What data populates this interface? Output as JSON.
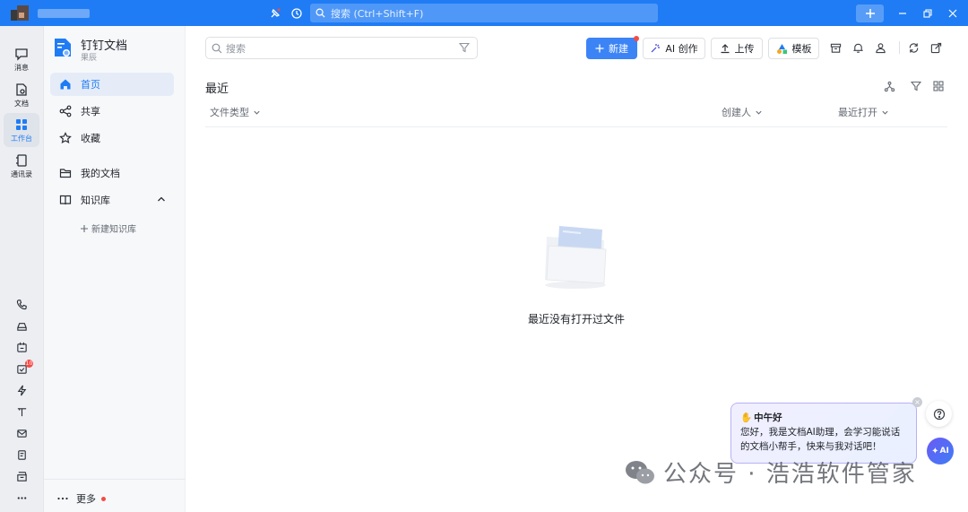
{
  "topbar": {
    "search_placeholder": "搜索 (Ctrl+Shift+F)"
  },
  "rail": {
    "items": [
      {
        "label": "消息",
        "icon": "message-icon"
      },
      {
        "label": "文档",
        "icon": "doc-icon"
      },
      {
        "label": "工作台",
        "icon": "workbench-icon"
      },
      {
        "label": "通讯录",
        "icon": "contacts-icon"
      }
    ],
    "badge_count": "10"
  },
  "sidebar": {
    "app_title": "钉钉文档",
    "app_subtitle": "果辰",
    "nav": [
      {
        "label": "首页",
        "icon": "home-icon"
      },
      {
        "label": "共享",
        "icon": "share-icon"
      },
      {
        "label": "收藏",
        "icon": "star-icon"
      },
      {
        "label": "我的文档",
        "icon": "folder-icon"
      },
      {
        "label": "知识库",
        "icon": "book-icon"
      }
    ],
    "new_kb": "新建知识库",
    "more": "更多"
  },
  "main": {
    "search_placeholder": "搜索",
    "buttons": {
      "new": "新建",
      "ai_create": "AI 创作",
      "upload": "上传",
      "template": "模板"
    },
    "section_title": "最近",
    "columns": {
      "file_type": "文件类型",
      "creator": "创建人",
      "last_opened": "最近打开"
    },
    "empty_text": "最近没有打开过文件"
  },
  "ai_assistant": {
    "greeting": "中午好",
    "message": "您好，我是文档AI助理，会学习能说话的文档小帮手，快来与我对话吧！",
    "button_label": "AI"
  },
  "watermark": {
    "text": "公众号 · 浩浩软件管家"
  },
  "colors": {
    "accent": "#1f7cf5",
    "primary_button": "#3c84f6",
    "badge": "#f54a45"
  }
}
